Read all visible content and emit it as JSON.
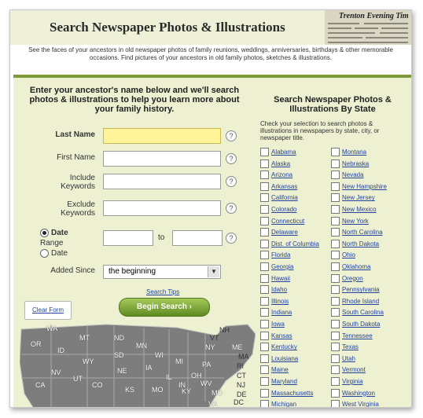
{
  "header": {
    "title": "Search Newspaper Photos & Illustrations",
    "clip_text": "Trenton Evening Tim"
  },
  "intro": "See the faces of your ancestors in old newspaper photos of family reunions, weddings, anniversaries, birthdays & other memorable occasions. Find pictures of your ancestors in old family photos, sketches & illustrations.",
  "form": {
    "heading": "Enter your ancestor's name below and we'll search photos & illustrations to help you learn more about your family history.",
    "last_name_label": "Last Name",
    "first_name_label": "First Name",
    "include_label": "Include Keywords",
    "exclude_label": "Exclude Keywords",
    "date_label": "Date",
    "range_label": "Range",
    "date2_label": "Date",
    "to_label": "to",
    "added_label": "Added Since",
    "added_value": "the beginning",
    "help_glyph": "?",
    "search_tips": "Search Tips",
    "clear_form": "Clear Form",
    "begin_search": "Begin Search ›"
  },
  "map": {
    "states": [
      "WA",
      "MT",
      "ND",
      "MN",
      "ME",
      "VT",
      "NH",
      "WI",
      "NY",
      "MA",
      "OR",
      "ID",
      "SD",
      "MI",
      "RI",
      "WY",
      "CT",
      "NE",
      "IA",
      "PA",
      "NJ",
      "NV",
      "UT",
      "IL",
      "IN",
      "OH",
      "DE",
      "CA",
      "CO",
      "KS",
      "MO",
      "KY",
      "WV",
      "MD",
      "DC",
      "VA"
    ]
  },
  "states_panel": {
    "heading": "Search Newspaper Photos & Illustrations By State",
    "description": "Check your selection to search photos & illustrations in newspapers by state, city, or newspaper title.",
    "col1": [
      "Alabama",
      "Alaska",
      "Arizona",
      "Arkansas",
      "California",
      "Colorado",
      "Connecticut",
      "Delaware",
      "Dist. of Columbia",
      "Florida",
      "Georgia",
      "Hawaii",
      "Idaho",
      "Illinois",
      "Indiana",
      "Iowa",
      "Kansas",
      "Kentucky",
      "Louisiana",
      "Maine",
      "Maryland",
      "Massachusetts",
      "Michigan"
    ],
    "col2": [
      "Montana",
      "Nebraska",
      "Nevada",
      "New Hampshire",
      "New Jersey",
      "New Mexico",
      "New York",
      "North Carolina",
      "North Dakota",
      "Ohio",
      "Oklahoma",
      "Oregon",
      "Pennsylvania",
      "Rhode Island",
      "South Carolina",
      "South Dakota",
      "Tennessee",
      "Texas",
      "Utah",
      "Vermont",
      "Virginia",
      "Washington",
      "West Virginia"
    ]
  }
}
